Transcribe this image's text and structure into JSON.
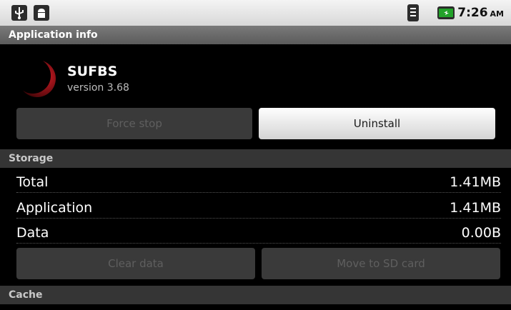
{
  "statusbar": {
    "icons": [
      "usb-icon",
      "android-icon",
      "wifi-icon",
      "battery-icon"
    ],
    "time": "7:26",
    "ampm": "AM"
  },
  "title": "Application info",
  "app": {
    "name": "SUFBS",
    "version": "version 3.68",
    "icon": "app-moon-icon"
  },
  "buttons": {
    "force_stop": "Force stop",
    "uninstall": "Uninstall",
    "clear_data": "Clear data",
    "move_sd": "Move to SD card"
  },
  "storage": {
    "header": "Storage",
    "rows": [
      {
        "label": "Total",
        "value": "1.41MB"
      },
      {
        "label": "Application",
        "value": "1.41MB"
      },
      {
        "label": "Data",
        "value": "0.00B"
      }
    ]
  },
  "cache": {
    "header": "Cache"
  },
  "colors": {
    "accent": "#b0121b",
    "battery": "#22a22a"
  }
}
